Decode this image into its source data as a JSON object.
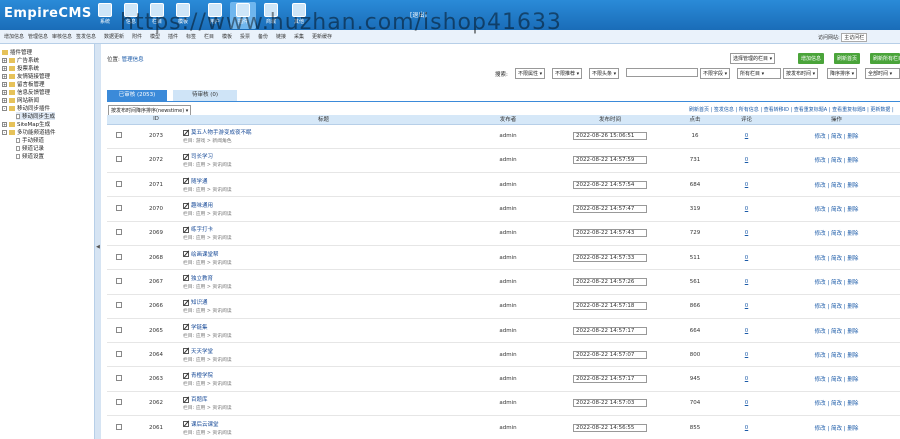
{
  "header": {
    "logo": "EmpireCMS",
    "user": "[退出]",
    "nav": [
      {
        "label": "系统",
        "icon": "system-icon"
      },
      {
        "label": "信息",
        "icon": "info-icon"
      },
      {
        "label": "栏目",
        "icon": "folder-icon"
      },
      {
        "label": "模板",
        "icon": "template-icon"
      },
      {
        "label": "用户",
        "icon": "user-icon"
      },
      {
        "label": "插件",
        "icon": "plugin-icon"
      },
      {
        "label": "商城",
        "icon": "shop-icon"
      },
      {
        "label": "其他",
        "icon": "gear-icon"
      }
    ]
  },
  "subbar": {
    "links": [
      "增加信息",
      "管理信息",
      "审核信息",
      "签发信息",
      "数据更新",
      "附件",
      "模型",
      "插件",
      "标签",
      "栏目",
      "模板",
      "投票",
      "备份",
      "链接",
      "采集",
      "更新缓存"
    ],
    "visit_label": "访问网站:",
    "visit_button": "主访问栏"
  },
  "sidebar": {
    "root": "插件管理",
    "items": [
      "广告系统",
      "投票系统",
      "友情链接管理",
      "留言板管理",
      "信息反馈管理",
      "网站新闻",
      "移动同步插件",
      "移动同步生成",
      "SiteMap生成",
      "多功能频道插件",
      "手动频道",
      "频道记录",
      "频道设置"
    ]
  },
  "main": {
    "location_label": "位置:",
    "location_link": "管理信息",
    "select_column": "选择管理的栏目",
    "buttons": [
      "增加信息",
      "刷新首页",
      "刷新所有栏目"
    ],
    "search_label": "搜索:",
    "search_filters": [
      "不限属性",
      "不限推荐",
      "不限头条"
    ],
    "search_field": "不限字段",
    "search_column": "所有栏目",
    "search_order1": "按发布时间",
    "search_order2": "降序排序",
    "search_time": "全部时间",
    "tabs": [
      "已审核 (2053)",
      "待审核 (0)"
    ],
    "sort_select": "按发布时间降序排序(newstime)",
    "top_links": "刷新首页 | 签发信息 | 所有信息 | 查看转移ID | 查看重复标题A | 查看重复标题B | 更新数据 |",
    "columns": [
      "",
      "ID",
      "标题",
      "发布者",
      "发布时间",
      "点击",
      "评论",
      "操作"
    ],
    "ops_label": "修改 | 简改 | 删除",
    "rows": [
      {
        "id": "2073",
        "title": "莫五人物手游变成夜不眠",
        "category": "栏目: 游戏 > 新闻角色",
        "author": "admin",
        "time": "2022-08-26 15:06:51",
        "clicks": "16",
        "comments": "0"
      },
      {
        "id": "2072",
        "title": "司长学习",
        "category": "栏目: 应用 > 资讯阅读",
        "author": "admin",
        "time": "2022-08-22 14:57:59",
        "clicks": "731",
        "comments": "0"
      },
      {
        "id": "2071",
        "title": "随学通",
        "category": "栏目: 应用 > 资讯阅读",
        "author": "admin",
        "time": "2022-08-22 14:57:54",
        "clicks": "684",
        "comments": "0"
      },
      {
        "id": "2070",
        "title": "趣味通用",
        "category": "栏目: 应用 > 资讯阅读",
        "author": "admin",
        "time": "2022-08-22 14:57:47",
        "clicks": "319",
        "comments": "0"
      },
      {
        "id": "2069",
        "title": "练字打卡",
        "category": "栏目: 应用 > 资讯阅读",
        "author": "admin",
        "time": "2022-08-22 14:57:43",
        "clicks": "729",
        "comments": "0"
      },
      {
        "id": "2068",
        "title": "绘画课堂帮",
        "category": "栏目: 应用 > 资讯阅读",
        "author": "admin",
        "time": "2022-08-22 14:57:33",
        "clicks": "511",
        "comments": "0"
      },
      {
        "id": "2067",
        "title": "独立教育",
        "category": "栏目: 应用 > 资讯阅读",
        "author": "admin",
        "time": "2022-08-22 14:57:26",
        "clicks": "561",
        "comments": "0"
      },
      {
        "id": "2066",
        "title": "知识通",
        "category": "栏目: 应用 > 资讯阅读",
        "author": "admin",
        "time": "2022-08-22 14:57:18",
        "clicks": "866",
        "comments": "0"
      },
      {
        "id": "2065",
        "title": "学链集",
        "category": "栏目: 应用 > 资讯阅读",
        "author": "admin",
        "time": "2022-08-22 14:57:17",
        "clicks": "664",
        "comments": "0"
      },
      {
        "id": "2064",
        "title": "天天学堂",
        "category": "栏目: 应用 > 资讯阅读",
        "author": "admin",
        "time": "2022-08-22 14:57:07",
        "clicks": "800",
        "comments": "0"
      },
      {
        "id": "2063",
        "title": "青橙学院",
        "category": "栏目: 应用 > 资讯阅读",
        "author": "admin",
        "time": "2022-08-22 14:57:17",
        "clicks": "945",
        "comments": "0"
      },
      {
        "id": "2062",
        "title": "百题库",
        "category": "栏目: 应用 > 资讯阅读",
        "author": "admin",
        "time": "2022-08-22 14:57:03",
        "clicks": "704",
        "comments": "0"
      },
      {
        "id": "2061",
        "title": "课后云课堂",
        "category": "栏目: 应用 > 资讯阅读",
        "author": "admin",
        "time": "2022-08-22 14:56:55",
        "clicks": "855",
        "comments": "0"
      }
    ]
  },
  "watermark": "https://www.huzhan.com/ishop41633"
}
